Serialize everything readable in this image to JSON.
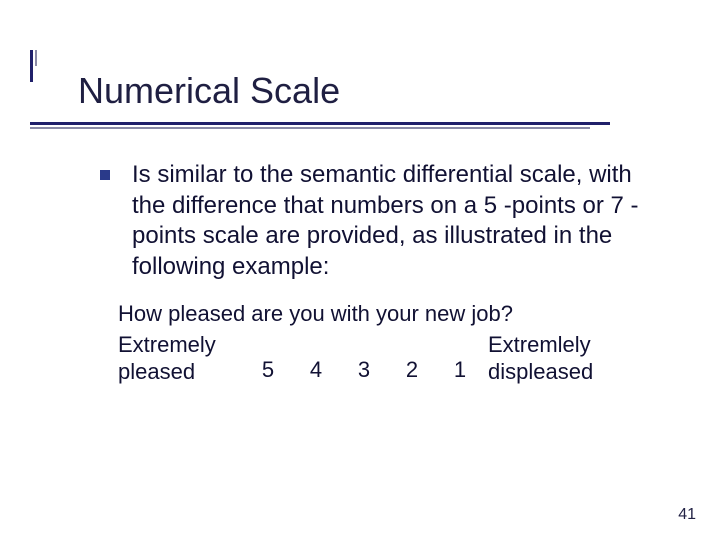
{
  "title": "Numerical Scale",
  "bullet": "Is similar to the semantic differential scale, with the difference that numbers on a 5 -points or 7 -points scale are provided, as illustrated in the following example:",
  "example": {
    "question": "How pleased are you with your new job?",
    "left_anchor_l1": "Extremely",
    "left_anchor_l2": "pleased",
    "right_anchor_l1": "Extremlely",
    "right_anchor_l2": "displeased",
    "n5": "5",
    "n4": "4",
    "n3": "3",
    "n2": "2",
    "n1": "1"
  },
  "page_number": "41"
}
